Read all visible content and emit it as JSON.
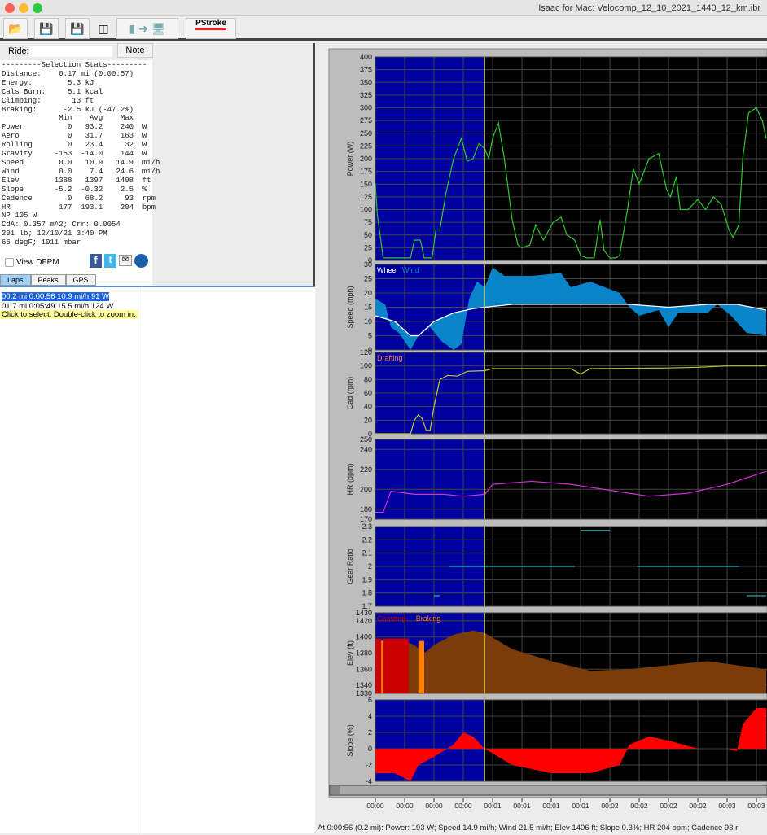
{
  "window": {
    "title": "Isaac for Mac:  Velocomp_12_10_2021_1440_12_km.ibr"
  },
  "toolbar": {
    "buttons": [
      {
        "icon": "open-folder-icon"
      },
      {
        "icon": "save-icon"
      },
      {
        "icon": "save-as-icon"
      },
      {
        "icon": "usb-icon"
      },
      {
        "icon": "device-to-computer-icon"
      },
      {
        "icon": "pstroke-icon",
        "label": "PStroke"
      }
    ]
  },
  "ride": {
    "label": "Ride:",
    "value": "",
    "note_label": "Note"
  },
  "stats": {
    "lines": [
      "---------Selection Stats---------",
      "Distance:    0.17 mi (0:00:57)",
      "Energy:        5.3 kJ",
      "Cals Burn:     5.1 kcal",
      "Climbing:       13 ft",
      "Braking:      -2.5 kJ (-47.2%)",
      "             Min    Avg    Max",
      "Power          0   93.2    240  W",
      "Aero           0   31.7    163  W",
      "Rolling        0   23.4     32  W",
      "Gravity     -153  -14.0    144  W",
      "Speed        0.0   10.9   14.9  mi/h",
      "Wind         0.0    7.4   24.6  mi/h",
      "Elev        1388   1397   1408  ft",
      "Slope       -5.2  -0.32    2.5  %",
      "Cadence        0   68.2     93  rpm",
      "HR           177  193.1    204  bpm",
      "NP 105 W",
      "CdA: 0.357 m^2; Crr: 0.0054",
      "201 lb; 12/10/21 3:40 PM",
      "66 degF; 1011 mbar"
    ]
  },
  "view_dfpm": {
    "label": "View DFPM",
    "checked": false
  },
  "share_icons": [
    "facebook-icon",
    "twitter-icon",
    "email-icon",
    "globe-icon"
  ],
  "tabs": [
    {
      "label": "Laps",
      "selected": true
    },
    {
      "label": "Peaks"
    },
    {
      "label": "GPS"
    }
  ],
  "laps": [
    "00.2 mi  0:00:56  10.9 mi/h  91 W",
    "01.7 mi  0:05:49  15.5 mi/h  124 W"
  ],
  "tooltip": "Click to select. Double-click to zoom in.",
  "status_bar": "At 0:00:56 (0.2 mi): Power: 193 W; Speed 14.9 mi/h; Wind 21.5 mi/h; Elev 1406 ft; Slope 0.3%; HR 204 bpm; Cadence 93 r",
  "colors": {
    "selection": "#0000a0",
    "plot_bg": "#000000",
    "power": "#2ec82e",
    "wind": "#0a84c8",
    "wheel": "#ffffff",
    "cadence": "#c8c832",
    "hr": "#d030d0",
    "gear": "#20c0c0",
    "elev": "#7a3c0a",
    "coasting": "#cc0000",
    "braking": "#ff7f00",
    "slope": "#ff0000"
  },
  "x_axis": {
    "ticks": [
      "00:00",
      "00:00",
      "00:00",
      "00:00",
      "00:01",
      "00:01",
      "00:01",
      "00:01",
      "00:02",
      "00:02",
      "00:02",
      "00:02",
      "00:03",
      "00:03"
    ]
  },
  "selection_end_s": 56,
  "chart_data": [
    {
      "type": "line",
      "ylabel": "Power (W)",
      "ylim": [
        0,
        400
      ],
      "yticks": [
        0,
        25,
        50,
        75,
        100,
        125,
        150,
        175,
        200,
        225,
        250,
        275,
        300,
        325,
        350,
        375,
        400
      ],
      "series": [
        {
          "color": "#2ec82e",
          "points": [
            [
              0,
              150
            ],
            [
              1,
              90
            ],
            [
              4,
              5
            ],
            [
              18,
              5
            ],
            [
              20,
              40
            ],
            [
              23,
              40
            ],
            [
              25,
              5
            ],
            [
              29,
              5
            ],
            [
              31,
              60
            ],
            [
              33,
              60
            ],
            [
              36,
              130
            ],
            [
              40,
              200
            ],
            [
              44,
              240
            ],
            [
              47,
              195
            ],
            [
              50,
              200
            ],
            [
              53,
              230
            ],
            [
              56,
              220
            ],
            [
              58,
              200
            ],
            [
              60,
              240
            ],
            [
              63,
              270
            ],
            [
              66,
              200
            ],
            [
              70,
              80
            ],
            [
              73,
              30
            ],
            [
              75,
              25
            ],
            [
              79,
              30
            ],
            [
              82,
              70
            ],
            [
              84,
              55
            ],
            [
              86,
              40
            ],
            [
              91,
              75
            ],
            [
              95,
              85
            ],
            [
              98,
              50
            ],
            [
              102,
              40
            ],
            [
              105,
              10
            ],
            [
              108,
              5
            ],
            [
              112,
              5
            ],
            [
              115,
              80
            ],
            [
              117,
              20
            ],
            [
              120,
              5
            ],
            [
              123,
              5
            ],
            [
              125,
              10
            ],
            [
              129,
              100
            ],
            [
              132,
              180
            ],
            [
              135,
              150
            ],
            [
              140,
              200
            ],
            [
              145,
              210
            ],
            [
              149,
              140
            ],
            [
              151,
              125
            ],
            [
              154,
              165
            ],
            [
              156,
              100
            ],
            [
              160,
              100
            ],
            [
              165,
              120
            ],
            [
              169,
              100
            ],
            [
              173,
              125
            ],
            [
              177,
              110
            ],
            [
              181,
              60
            ],
            [
              183,
              45
            ],
            [
              186,
              70
            ],
            [
              188,
              200
            ],
            [
              191,
              290
            ],
            [
              195,
              300
            ],
            [
              198,
              275
            ],
            [
              200,
              240
            ]
          ]
        }
      ]
    },
    {
      "type": "area",
      "ylabel": "Speed (mph)",
      "ylim": [
        0,
        30
      ],
      "yticks": [
        0,
        5,
        10,
        15,
        20,
        25,
        30
      ],
      "legend": [
        "Wheel",
        "Wind"
      ],
      "series": [
        {
          "name": "Wheel",
          "points": [
            [
              0,
              12
            ],
            [
              10,
              10
            ],
            [
              18,
              5
            ],
            [
              22,
              5
            ],
            [
              30,
              10
            ],
            [
              40,
              13
            ],
            [
              50,
              14.5
            ],
            [
              56,
              15
            ],
            [
              70,
              16
            ],
            [
              130,
              16
            ],
            [
              150,
              15
            ],
            [
              170,
              16
            ],
            [
              185,
              16
            ],
            [
              200,
              14
            ]
          ]
        },
        {
          "name": "Wind",
          "points": [
            [
              0,
              18
            ],
            [
              5,
              16
            ],
            [
              8,
              8
            ],
            [
              12,
              6
            ],
            [
              18,
              0
            ],
            [
              22,
              5
            ],
            [
              28,
              8
            ],
            [
              34,
              3
            ],
            [
              40,
              0
            ],
            [
              44,
              2
            ],
            [
              48,
              18
            ],
            [
              52,
              24
            ],
            [
              56,
              22
            ],
            [
              60,
              29
            ],
            [
              66,
              26
            ],
            [
              80,
              26
            ],
            [
              95,
              27
            ],
            [
              100,
              22
            ],
            [
              110,
              24
            ],
            [
              125,
              20
            ],
            [
              130,
              15
            ],
            [
              135,
              12
            ],
            [
              145,
              14
            ],
            [
              150,
              8
            ],
            [
              155,
              13
            ],
            [
              170,
              13
            ],
            [
              175,
              16
            ],
            [
              182,
              12
            ],
            [
              190,
              6
            ],
            [
              200,
              5
            ]
          ]
        }
      ]
    },
    {
      "type": "line",
      "ylabel": "Cad (rpm)",
      "ylim": [
        0,
        120
      ],
      "yticks": [
        0,
        20,
        40,
        60,
        80,
        100,
        120
      ],
      "legend": [
        "Drafting"
      ],
      "series": [
        {
          "color": "#c8c832",
          "points": [
            [
              0,
              0
            ],
            [
              18,
              0
            ],
            [
              20,
              20
            ],
            [
              22,
              28
            ],
            [
              24,
              22
            ],
            [
              26,
              5
            ],
            [
              28,
              5
            ],
            [
              30,
              40
            ],
            [
              33,
              80
            ],
            [
              37,
              86
            ],
            [
              42,
              85
            ],
            [
              47,
              92
            ],
            [
              56,
              93
            ],
            [
              60,
              96
            ],
            [
              100,
              96
            ],
            [
              105,
              88
            ],
            [
              110,
              96
            ],
            [
              150,
              97
            ],
            [
              165,
              98
            ],
            [
              180,
              100
            ],
            [
              200,
              100
            ]
          ]
        }
      ]
    },
    {
      "type": "line",
      "ylabel": "HR (bpm)",
      "ylim": [
        170,
        250
      ],
      "yticks": [
        170,
        180,
        200,
        220,
        240,
        250
      ],
      "series": [
        {
          "color": "#d030d0",
          "points": [
            [
              0,
              177
            ],
            [
              4,
              177
            ],
            [
              8,
              198
            ],
            [
              20,
              195
            ],
            [
              35,
              195
            ],
            [
              45,
              193
            ],
            [
              56,
              195
            ],
            [
              60,
              205
            ],
            [
              80,
              208
            ],
            [
              100,
              205
            ],
            [
              140,
              193
            ],
            [
              160,
              196
            ],
            [
              180,
              205
            ],
            [
              200,
              218
            ]
          ]
        }
      ]
    },
    {
      "type": "segments",
      "ylabel": "Gear Ratio",
      "ylim": [
        1.7,
        2.3
      ],
      "yticks": [
        1.7,
        1.8,
        1.9,
        2,
        2.1,
        2.2,
        2.3
      ],
      "segments": [
        [
          30,
          33,
          1.78
        ],
        [
          38,
          102,
          2.0
        ],
        [
          105,
          120,
          2.27
        ],
        [
          134,
          186,
          2.0
        ],
        [
          190,
          200,
          1.78
        ]
      ]
    },
    {
      "type": "area",
      "ylabel": "Elev (ft)",
      "ylim": [
        1330,
        1430
      ],
      "yticks": [
        1330,
        1340,
        1360,
        1380,
        1400,
        1420,
        1430
      ],
      "legend": [
        "Coasting",
        "Braking"
      ],
      "points": [
        [
          0,
          1398
        ],
        [
          5,
          1395
        ],
        [
          15,
          1395
        ],
        [
          20,
          1390
        ],
        [
          25,
          1380
        ],
        [
          30,
          1390
        ],
        [
          40,
          1403
        ],
        [
          50,
          1408
        ],
        [
          56,
          1405
        ],
        [
          70,
          1385
        ],
        [
          90,
          1370
        ],
        [
          110,
          1358
        ],
        [
          130,
          1360
        ],
        [
          150,
          1365
        ],
        [
          170,
          1370
        ],
        [
          185,
          1365
        ],
        [
          200,
          1360
        ]
      ],
      "coasting": [
        [
          0,
          3
        ],
        [
          4,
          17
        ]
      ],
      "braking": [
        [
          3,
          4
        ],
        [
          22,
          25
        ]
      ]
    },
    {
      "type": "area",
      "ylabel": "Slope (%)",
      "ylim": [
        -4,
        6
      ],
      "yticks": [
        -4,
        -2,
        0,
        2,
        4,
        6
      ],
      "points": [
        [
          0,
          -3
        ],
        [
          10,
          -3
        ],
        [
          18,
          -4
        ],
        [
          22,
          -2
        ],
        [
          30,
          -1
        ],
        [
          40,
          0.5
        ],
        [
          45,
          2
        ],
        [
          50,
          1.5
        ],
        [
          56,
          0
        ],
        [
          70,
          -2
        ],
        [
          90,
          -3
        ],
        [
          110,
          -3
        ],
        [
          125,
          -2
        ],
        [
          130,
          0.5
        ],
        [
          140,
          1.5
        ],
        [
          150,
          1
        ],
        [
          165,
          0
        ],
        [
          180,
          0
        ],
        [
          185,
          -0.3
        ],
        [
          188,
          3
        ],
        [
          195,
          5
        ],
        [
          200,
          5
        ]
      ]
    }
  ]
}
